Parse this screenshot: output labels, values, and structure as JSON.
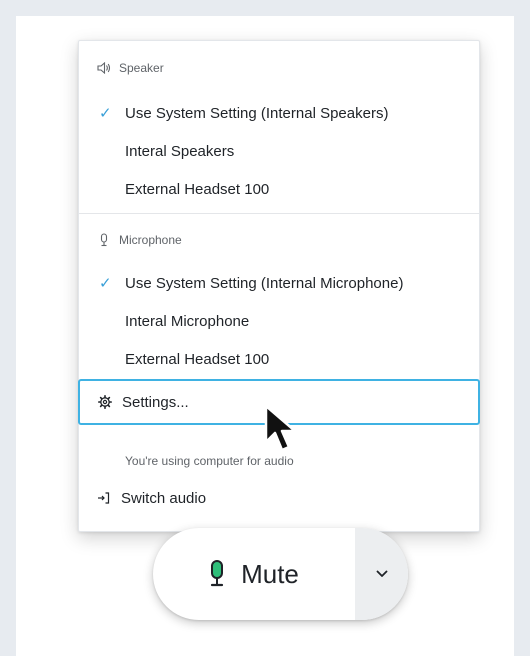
{
  "menu": {
    "speaker": {
      "header": "Speaker",
      "items": [
        {
          "label": "Use System Setting (Internal Speakers)",
          "checked": true
        },
        {
          "label": "Interal Speakers",
          "checked": false
        },
        {
          "label": "External Headset 100",
          "checked": false
        }
      ]
    },
    "microphone": {
      "header": "Microphone",
      "items": [
        {
          "label": "Use System Setting (Internal Microphone)",
          "checked": true
        },
        {
          "label": "Interal Microphone",
          "checked": false
        },
        {
          "label": "External Headset 100",
          "checked": false
        }
      ]
    },
    "settings_label": "Settings...",
    "info_text": "You're using computer for audio",
    "switch_audio_label": "Switch audio"
  },
  "mute_button": {
    "label": "Mute",
    "icon": "microphone-icon",
    "mic_color": "#2ebf7a"
  },
  "icons": {
    "speaker": "speaker-icon",
    "microphone_small": "microphone-small-icon",
    "settings": "gear-icon",
    "switch": "switch-audio-icon",
    "checkmark": "checkmark-icon",
    "chevron": "chevron-down-icon",
    "cursor": "mouse-cursor-icon"
  },
  "colors": {
    "accent": "#3aa0d8",
    "focus_border": "#3fb2e3"
  }
}
